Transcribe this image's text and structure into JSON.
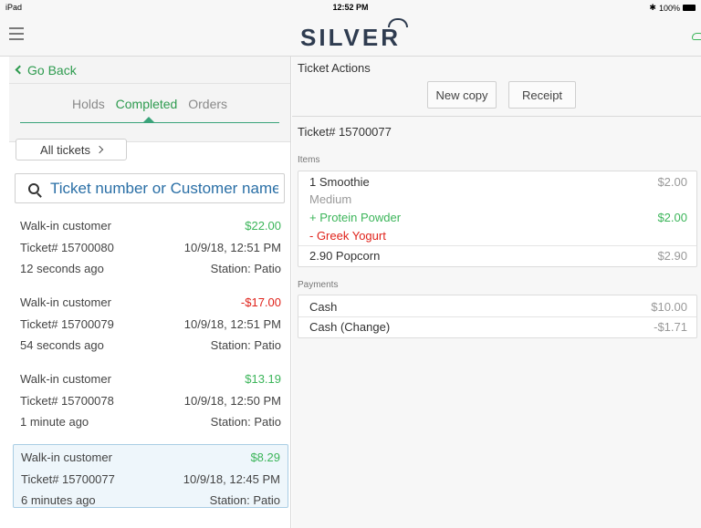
{
  "status_bar": {
    "device": "iPad",
    "time": "12:52 PM",
    "battery": "100%"
  },
  "nav": {
    "brand": "SILVER"
  },
  "left": {
    "back_label": "Go Back",
    "tabs": [
      {
        "label": "Holds",
        "active": false
      },
      {
        "label": "Completed",
        "active": true
      },
      {
        "label": "Orders",
        "active": false
      }
    ],
    "filter_label": "All tickets",
    "search_placeholder": "Ticket number or Customer name",
    "tickets": [
      {
        "customer": "Walk-in customer",
        "amount": "$22.00",
        "amount_color": "#3cb55a",
        "ticket": "Ticket# 15700080",
        "datetime": "10/9/18, 12:51 PM",
        "ago": "12 seconds ago",
        "station": "Station: Patio",
        "selected": false
      },
      {
        "customer": "Walk-in customer",
        "amount": "-$17.00",
        "amount_color": "#e0231b",
        "ticket": "Ticket# 15700079",
        "datetime": "10/9/18, 12:51 PM",
        "ago": "54 seconds ago",
        "station": "Station: Patio",
        "selected": false
      },
      {
        "customer": "Walk-in customer",
        "amount": "$13.19",
        "amount_color": "#3cb55a",
        "ticket": "Ticket# 15700078",
        "datetime": "10/9/18, 12:50 PM",
        "ago": "1 minute ago",
        "station": "Station: Patio",
        "selected": false
      },
      {
        "customer": "Walk-in customer",
        "amount": "$8.29",
        "amount_color": "#3cb55a",
        "ticket": "Ticket# 15700077",
        "datetime": "10/9/18, 12:45 PM",
        "ago": "6 minutes ago",
        "station": "Station: Patio",
        "selected": true
      }
    ]
  },
  "right": {
    "title": "Ticket Actions",
    "new_copy_label": "New copy",
    "receipt_label": "Receipt",
    "ticket_number": "Ticket# 15700077",
    "items_label": "Items",
    "items": {
      "smoothie_name": "1 Smoothie",
      "smoothie_price": "$2.00",
      "smoothie_size": "Medium",
      "mod_add": "+ Protein Powder",
      "mod_add_price": "$2.00",
      "mod_remove": "- Greek Yogurt",
      "popcorn_name": "2.90 Popcorn",
      "popcorn_price": "$2.90"
    },
    "payments_label": "Payments",
    "payments": [
      {
        "method": "Cash",
        "amount": "$10.00"
      },
      {
        "method": "Cash (Change)",
        "amount": "-$1.71"
      }
    ]
  },
  "colors": {
    "accent_green": "#3cb55a",
    "negative_red": "#e0231b",
    "brand_navy": "#2f3c50"
  }
}
